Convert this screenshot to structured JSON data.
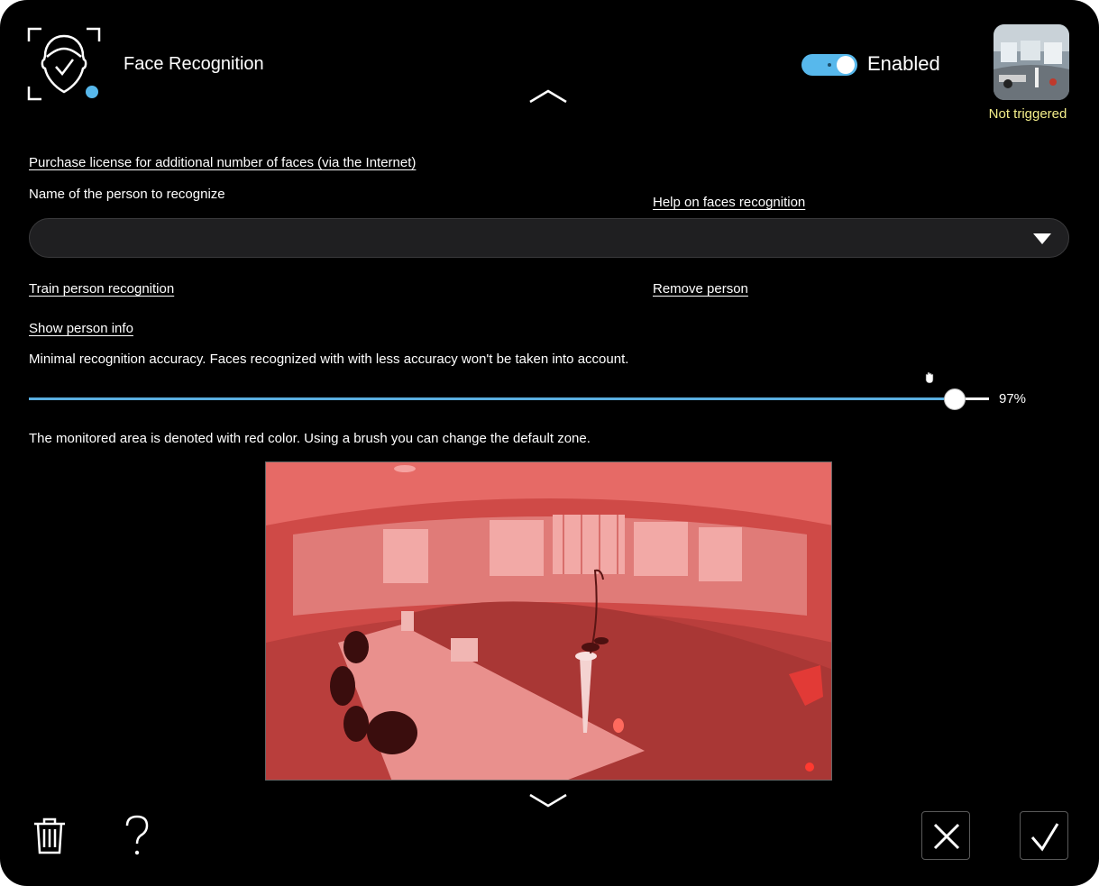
{
  "header": {
    "title": "Face Recognition",
    "toggle": {
      "on": true,
      "label": "Enabled"
    },
    "camera_status": "Not triggered"
  },
  "links": {
    "purchase_license": "Purchase license for additional number of faces (via the Internet)",
    "help_faces": "Help on faces recognition",
    "train_person": "Train person recognition",
    "remove_person": "Remove person",
    "show_person_info": "Show person info"
  },
  "person_select": {
    "label": "Name of the person to recognize",
    "value": ""
  },
  "accuracy": {
    "description": "Minimal recognition accuracy. Faces recognized with with less accuracy won't be taken into account.",
    "value_text": "97%",
    "fraction": 0.965
  },
  "zone": {
    "description": "The monitored area is denoted with red color. Using a brush you can change the default zone.",
    "overlay_color": "#e6514f"
  },
  "colors": {
    "background": "#000000",
    "accent": "#57b8ec",
    "status": "#f4ee8a"
  },
  "icons": {
    "face": "face-recognition-icon",
    "collapse": "chevron-up-icon",
    "expand": "chevron-down-icon",
    "delete": "trash-icon",
    "help": "question-mark-icon",
    "cancel": "close-icon",
    "confirm": "checkmark-icon"
  }
}
